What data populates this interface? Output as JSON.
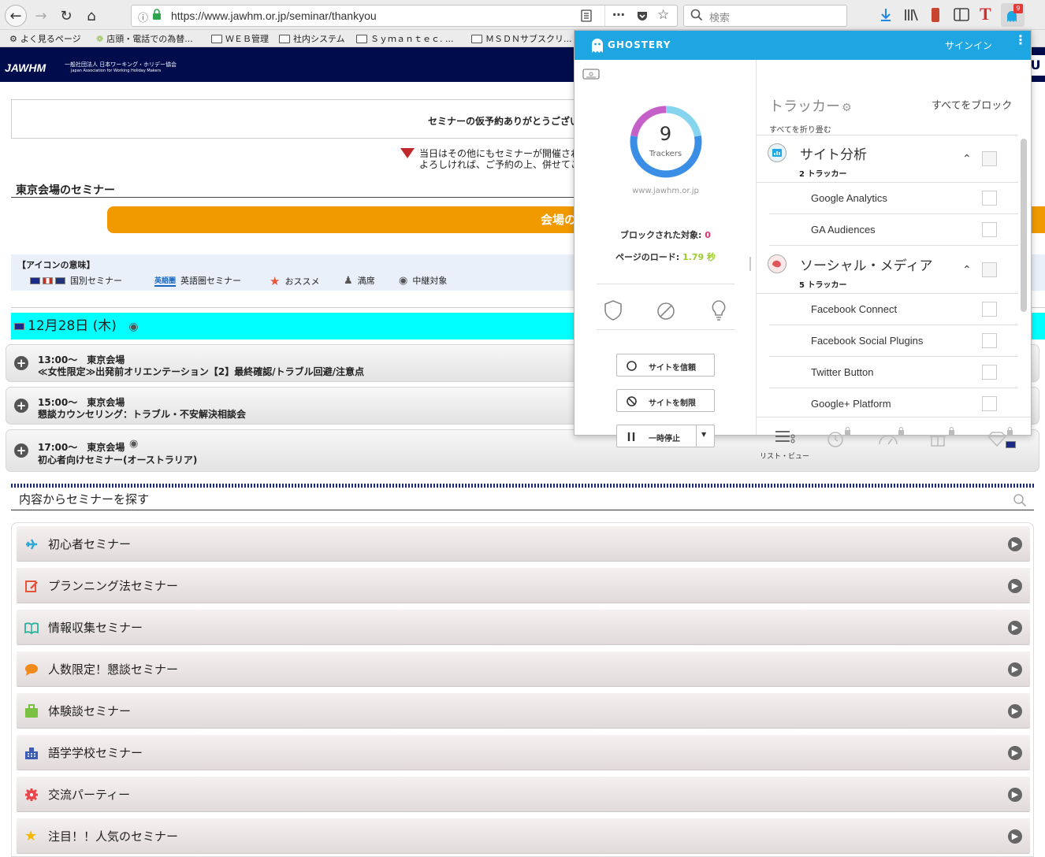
{
  "browser": {
    "url": "https://www.jawhm.or.jp/seminar/thankyou",
    "search_placeholder": "検索",
    "ghostery_badge": "9",
    "bookmarks": [
      {
        "label": "よく見るページ"
      },
      {
        "label": "店頭・電話での為替..."
      },
      {
        "label": "ＷＥＢ管理"
      },
      {
        "label": "社内システム"
      },
      {
        "label": "Ｓｙｍａｎｔｅｃ. ..."
      },
      {
        "label": "ＭＳＤＮサブスクリ..."
      }
    ]
  },
  "site": {
    "logo": "JAWHM",
    "logo_sub1": "一般社団法人 日本ワーキング・ホリデー協会",
    "logo_sub2": "Japan Association for Working Holiday Makers",
    "thanks": "セミナーの仮予約ありがとうござい",
    "notice_line1": "当日はその他にもセミナーが開催され",
    "notice_line2": "よろしければ、ご予約の上、併せてこ",
    "section_title": "東京会場のセミナー",
    "venue_button": "会場のご案内",
    "legend_title": "【アイコンの意味】",
    "legend": [
      {
        "label": "国別セミナー"
      },
      {
        "label": "英語圏セミナー",
        "badge": "英語圏"
      },
      {
        "label": "おススメ"
      },
      {
        "label": "満席"
      },
      {
        "label": "中継対象"
      }
    ],
    "date": "12月28日 (木)",
    "seminars": [
      {
        "time": "13:00〜　東京会場",
        "title": "≪女性限定≫出発前オリエンテーション【2】最終確認/トラブル回避/注意点"
      },
      {
        "time": "15:00〜　東京会場",
        "title": "懇談カウンセリング：トラブル・不安解決相談会"
      },
      {
        "time": "17:00〜　東京会場",
        "title": "初心者向けセミナー(オーストラリア)"
      }
    ],
    "find_title": "内容からセミナーを探す",
    "categories": [
      {
        "label": "初心者セミナー",
        "color": "#2aa8d8"
      },
      {
        "label": "プランニング法セミナー",
        "color": "#e8543a"
      },
      {
        "label": "情報収集セミナー",
        "color": "#2bb39a"
      },
      {
        "label": "人数限定！懇談セミナー",
        "color": "#f08a1c"
      },
      {
        "label": "体験談セミナー",
        "color": "#7ac143"
      },
      {
        "label": "語学学校セミナー",
        "color": "#3b5bb5"
      },
      {
        "label": "交流パーティー",
        "color": "#e8454a"
      },
      {
        "label": "注目！！人気のセミナー",
        "color": "#f5b800"
      }
    ]
  },
  "ghostery": {
    "brand": "GHOSTERY",
    "signin": "サインイン",
    "tracker_count": "9",
    "trackers_word": "Trackers",
    "domain": "www.jawhm.or.jp",
    "blocked_label": "ブロックされた対象: ",
    "blocked_value": "0",
    "load_label": "ページのロード: ",
    "load_value": "1.79 秒",
    "trust_button": "サイトを信頼",
    "restrict_button": "サイトを制限",
    "pause_button": "一時停止",
    "trackers_title": "トラッカー",
    "block_all": "すべてをブロック",
    "collapse_all": "すべてを折り畳む",
    "footer_label": "リスト・ビュー",
    "donut": [
      {
        "name": "site-analytics",
        "value": 2,
        "color": "#87d4ee"
      },
      {
        "name": "social-media",
        "value": 5,
        "color": "#3a8ee6"
      },
      {
        "name": "advertising",
        "value": 2,
        "color": "#c660c9"
      }
    ],
    "categories": [
      {
        "name": "サイト分析",
        "count": "2 トラッカー",
        "trackers": [
          "Google Analytics",
          "GA Audiences"
        ]
      },
      {
        "name": "ソーシャル・メディア",
        "count": "5 トラッカー",
        "trackers": [
          "Facebook Connect",
          "Facebook Social Plugins",
          "Twitter Button",
          "Google+ Platform"
        ]
      }
    ]
  }
}
